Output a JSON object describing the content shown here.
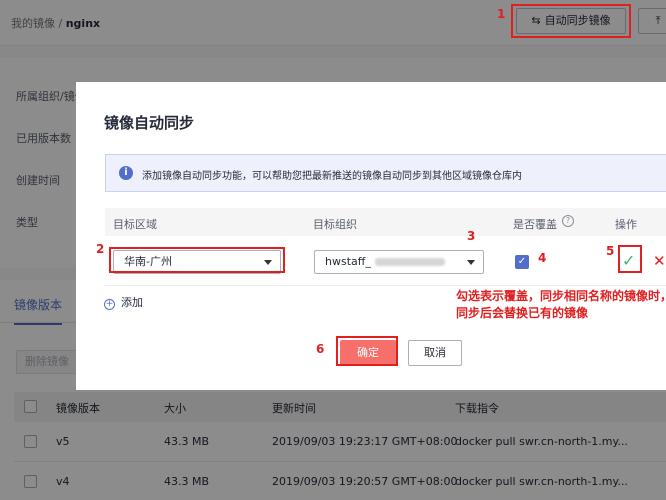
{
  "breadcrumb": {
    "root": "我的镜像",
    "separator": "/",
    "current": "nginx"
  },
  "toolbar": {
    "sync_label": "自动同步镜像",
    "sync_icon": "swap-icon",
    "upload_icon": "upload-icon"
  },
  "info_labels": [
    "所属组织/镜像",
    "已用版本数",
    "创建时间",
    "类型"
  ],
  "versions": {
    "tab": "镜像版本",
    "delete_label": "删除镜像",
    "columns": [
      "镜像版本",
      "大小",
      "更新时间",
      "下载指令"
    ],
    "rows": [
      {
        "version": "v5",
        "size": "43.3 MB",
        "updated": "2019/09/03 19:23:17 GMT+08:00",
        "command": "docker pull swr.cn-north-1.my..."
      },
      {
        "version": "v4",
        "size": "43.3 MB",
        "updated": "2019/09/03 19:20:57 GMT+08:00",
        "command": "docker pull swr.cn-north-1.my..."
      }
    ]
  },
  "modal": {
    "title": "镜像自动同步",
    "info_text": "添加镜像自动同步功能，可以帮助您把最新推送的镜像自动同步到其他区域镜像仓库内",
    "columns": {
      "region": "目标区域",
      "org": "目标组织",
      "overwrite": "是否覆盖",
      "action": "操作"
    },
    "row": {
      "region": "华南-广州",
      "org": "hwstaff_",
      "overwrite_checked": true
    },
    "add_label": "添加",
    "confirm_label": "确定",
    "cancel_label": "取消",
    "annotation": "勾选表示覆盖，同步相同名称的镜像时，同步后会替换已有的镜像"
  },
  "step_numbers": [
    "1",
    "2",
    "3",
    "4",
    "5",
    "6"
  ],
  "colors": {
    "accent": "#526ecc",
    "annotation_red": "#e02020",
    "confirm_bg": "#f66f6a",
    "success_green": "#3cb371"
  }
}
